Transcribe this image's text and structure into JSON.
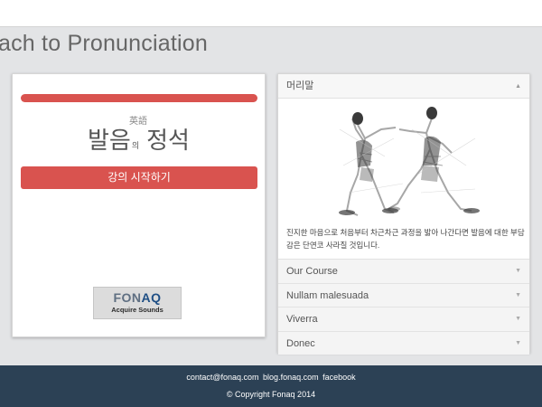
{
  "page": {
    "title": "ach to Pronunciation"
  },
  "left_card": {
    "logo_small": "英語",
    "logo_part1": "발음",
    "logo_mid": "의",
    "logo_part3": "정석",
    "start_button": "강의 시작하기",
    "badge_prefix": "FON",
    "badge_highlight": "AQ",
    "badge_sub": "Acquire Sounds"
  },
  "accordion": {
    "open_section": {
      "title": "머리말",
      "caret": "▲",
      "illustration": "basketball-players-illustration",
      "text": "진지한 마음으로 처음부터 차근차근 과정을 밟아 나간다면 발음에 대한 부담감은 단연코 사라질 것입니다."
    },
    "items": [
      {
        "label": "Our Course",
        "caret": "▼"
      },
      {
        "label": "Nullam malesuada",
        "caret": "▼"
      },
      {
        "label": "Viverra",
        "caret": "▼"
      },
      {
        "label": "Donec",
        "caret": "▼"
      }
    ]
  },
  "footer": {
    "links": [
      "contact@fonaq.com",
      "blog.fonaq.com",
      "facebook"
    ],
    "copyright": "© Copyright Fonaq 2014"
  },
  "colors": {
    "accent_red": "#d9534f",
    "footer_bg": "#2c4155",
    "background": "#e3e4e6"
  }
}
